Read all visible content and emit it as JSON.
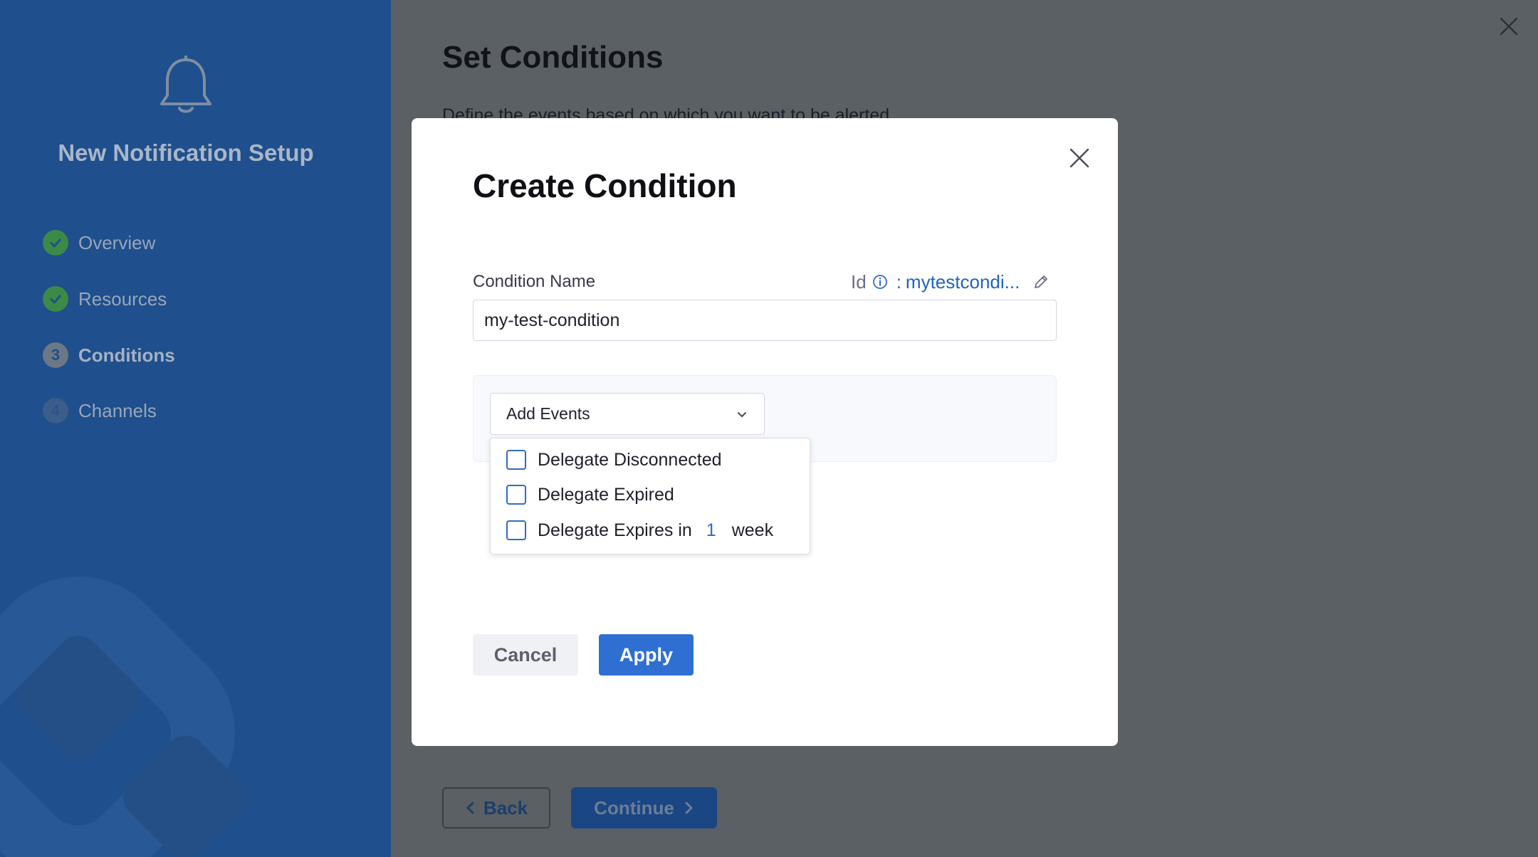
{
  "wizard": {
    "title": "New Notification Setup",
    "steps": [
      {
        "label": "Overview",
        "status": "done"
      },
      {
        "label": "Resources",
        "status": "done"
      },
      {
        "label": "Conditions",
        "status": "current",
        "number": "3"
      },
      {
        "label": "Channels",
        "status": "todo",
        "number": "4"
      }
    ]
  },
  "page": {
    "title": "Set Conditions",
    "subtitle": "Define the events based on which you want to be alerted",
    "back_label": "Back",
    "continue_label": "Continue"
  },
  "modal": {
    "title": "Create Condition",
    "condition_name_label": "Condition Name",
    "condition_name_value": "my-test-condition",
    "id_label": "Id",
    "id_separator": ":",
    "id_value": "mytestcondi...",
    "events_select_label": "Add Events",
    "event_options": [
      {
        "label": "Delegate Disconnected",
        "checked": false
      },
      {
        "label": "Delegate Expired",
        "checked": false
      },
      {
        "label": "Delegate Expires in",
        "checked": false,
        "number": "1",
        "suffix": "week"
      }
    ],
    "cancel_label": "Cancel",
    "apply_label": "Apply"
  },
  "colors": {
    "sidebar": "#1f4f8c",
    "overlay": "#5a6064",
    "primary": "#2f6fd2",
    "link": "#1f62c3",
    "success": "#3b8a47"
  }
}
